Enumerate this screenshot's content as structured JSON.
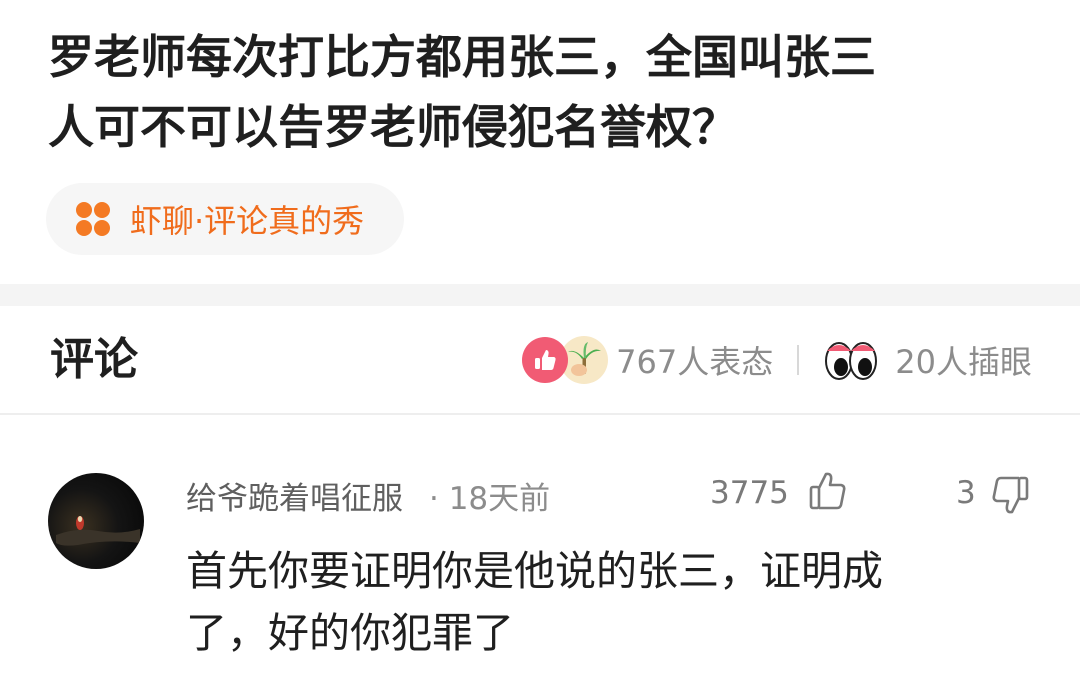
{
  "question": {
    "title_line1": "罗老师每次打比方都用张三，全国叫张三",
    "title_line2": "人可不可以告罗老师侵犯名誉权？"
  },
  "topic": {
    "icon": "four-dots-icon",
    "label": "虾聊·评论真的秀",
    "color": "#f06c1c"
  },
  "comments_section": {
    "heading": "评论",
    "reactions": {
      "like_count_text": "767人表态",
      "eyes_count_text": "20人插眼"
    }
  },
  "comment": {
    "username": "给爷跪着唱征服",
    "time": "· 18天前",
    "like_count": "3775",
    "dislike_count": "3",
    "body_line1": "首先你要证明你是他说的张三，证明成",
    "body_line2": "了，好的你犯罪了"
  }
}
